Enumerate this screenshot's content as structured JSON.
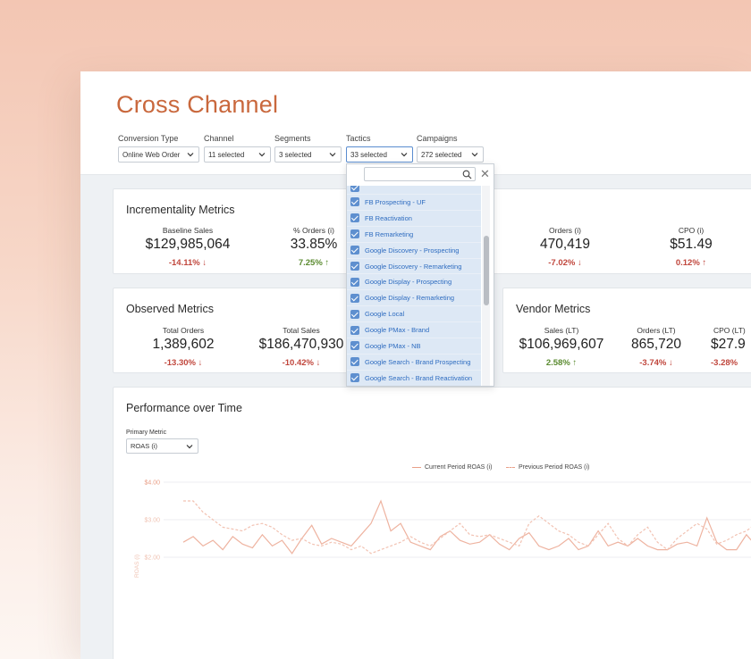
{
  "page_title": "Cross Channel",
  "filters": [
    {
      "label": "Conversion Type",
      "value": "Online Web Order"
    },
    {
      "label": "Channel",
      "value": "11 selected"
    },
    {
      "label": "Segments",
      "value": "3 selected"
    },
    {
      "label": "Tactics",
      "value": "33 selected"
    },
    {
      "label": "Campaigns",
      "value": "272 selected"
    }
  ],
  "tactics_dropdown": {
    "search_placeholder": "",
    "items": [
      "FB Prospecting - UF",
      "FB Reactivation",
      "FB Remarketing",
      "Google Discovery - Prospecting",
      "Google Discovery - Remarketing",
      "Google Display - Prospecting",
      "Google Display - Remarketing",
      "Google Local",
      "Google PMax - Brand",
      "Google PMax - NB",
      "Google Search - Brand Prospecting",
      "Google Search - Brand Reactivation"
    ]
  },
  "incrementality": {
    "title": "Incrementality Metrics",
    "metrics": [
      {
        "label": "Baseline Sales",
        "value": "$129,985,064",
        "change": "-14.11%",
        "direction": "down"
      },
      {
        "label": "% Orders (i)",
        "value": "33.85%",
        "change": "7.25%",
        "direction": "up"
      },
      {
        "label": "Orders (i)",
        "value": "470,419",
        "change": "-7.02%",
        "direction": "down"
      },
      {
        "label": "CPO (i)",
        "value": "$51.49",
        "change": "0.12%",
        "direction": "up"
      }
    ]
  },
  "observed": {
    "title": "Observed Metrics",
    "metrics": [
      {
        "label": "Total Orders",
        "value": "1,389,602",
        "change": "-13.30%",
        "direction": "down"
      },
      {
        "label": "Total Sales",
        "value": "$186,470,930",
        "change": "-10.42%",
        "direction": "down"
      }
    ]
  },
  "vendor": {
    "title": "Vendor Metrics",
    "metrics": [
      {
        "label": "Sales (LT)",
        "value": "$106,969,607",
        "change": "2.58%",
        "direction": "up"
      },
      {
        "label": "Orders (LT)",
        "value": "865,720",
        "change": "-3.74%",
        "direction": "down"
      },
      {
        "label": "CPO (LT)",
        "value": "$27.9",
        "change": "-3.28%",
        "direction": "down"
      }
    ]
  },
  "performance": {
    "title": "Performance over Time",
    "primary_metric_label": "Primary Metric",
    "primary_metric_value": "ROAS (i)",
    "legend_current": "Current Period ROAS (i)",
    "legend_previous": "Previous Period ROAS (i)",
    "ylabel": "ROAS (i)",
    "yticks": [
      "$4.00",
      "$3.00",
      "$2.00"
    ]
  },
  "chart_data": {
    "type": "line",
    "ylabel": "ROAS (i)",
    "ylim": [
      2.0,
      4.0
    ],
    "series": [
      {
        "name": "Current Period ROAS (i)",
        "values": [
          2.4,
          2.55,
          2.3,
          2.45,
          2.2,
          2.55,
          2.35,
          2.25,
          2.6,
          2.3,
          2.45,
          2.1,
          2.5,
          2.85,
          2.35,
          2.5,
          2.4,
          2.3,
          2.6,
          2.9,
          3.5,
          2.7,
          2.9,
          2.4,
          2.3,
          2.2,
          2.55,
          2.7,
          2.45,
          2.35,
          2.4,
          2.6,
          2.35,
          2.2,
          2.5,
          2.65,
          2.3,
          2.2,
          2.3,
          2.5,
          2.2,
          2.3,
          2.7,
          2.3,
          2.4,
          2.3,
          2.5,
          2.3,
          2.2,
          2.2,
          2.35,
          2.4,
          2.3,
          3.05,
          2.4,
          2.2,
          2.2,
          2.6,
          2.3,
          2.6
        ]
      },
      {
        "name": "Previous Period ROAS (i)",
        "values": [
          3.5,
          3.5,
          3.2,
          3.0,
          2.8,
          2.75,
          2.7,
          2.85,
          2.9,
          2.8,
          2.6,
          2.45,
          2.5,
          2.35,
          2.3,
          2.4,
          2.35,
          2.2,
          2.3,
          2.1,
          2.2,
          2.3,
          2.4,
          2.55,
          2.4,
          2.3,
          2.5,
          2.7,
          2.9,
          2.6,
          2.55,
          2.6,
          2.5,
          2.4,
          2.3,
          2.9,
          3.1,
          2.9,
          2.7,
          2.6,
          2.4,
          2.3,
          2.6,
          2.9,
          2.5,
          2.3,
          2.6,
          2.8,
          2.4,
          2.2,
          2.5,
          2.7,
          2.9,
          2.75,
          2.35,
          2.45,
          2.6,
          2.7,
          2.9,
          2.65
        ]
      }
    ]
  },
  "colors": {
    "title": "#c9683d",
    "negative": "#c0463c",
    "positive": "#5a8a2f",
    "selected_item_bg": "#dde8f5",
    "selected_item_text": "#2e6cc0",
    "line": "#e9a088"
  }
}
